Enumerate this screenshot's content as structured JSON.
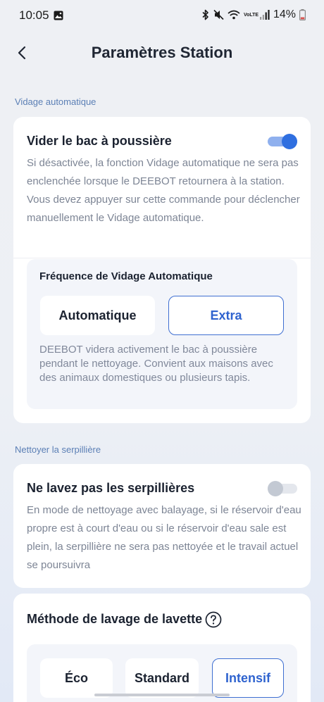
{
  "status_bar": {
    "time": "10:05",
    "battery": "14%",
    "icons": [
      "gallery-icon",
      "bluetooth-icon",
      "mute-icon",
      "wifi-icon",
      "volte-icon",
      "signal-icon",
      "battery-icon"
    ],
    "volte_text": "VoLTE"
  },
  "header": {
    "title": "Paramètres Station",
    "back_icon": "chevron-left-icon"
  },
  "auto_empty": {
    "section_label": "Vidage automatique",
    "toggle_title": "Vider le bac à poussière",
    "toggle_on": true,
    "description": "Si désactivée, la fonction Vidage automatique ne sera pas enclenchée lorsque le DEEBOT retournera à la station. Vous devez appuyer sur cette commande pour déclencher manuellement le Vidage automatique.",
    "frequency": {
      "title": "Fréquence de Vidage Automatique",
      "options": [
        "Automatique",
        "Extra"
      ],
      "selected": "Extra",
      "description": "DEEBOT videra activement le bac à poussière pendant le nettoyage. Convient aux maisons avec des animaux domestiques ou plusieurs tapis."
    }
  },
  "mop_clean": {
    "section_label": "Nettoyer la serpillière",
    "toggle_title": "Ne lavez pas les serpillières",
    "toggle_on": false,
    "description": "En mode de nettoyage avec balayage, si le réservoir d'eau propre est à court d'eau ou si le réservoir d'eau sale est plein, la serpillière ne sera pas nettoyée et le travail actuel se poursuivra"
  },
  "wash_method": {
    "title": "Méthode de lavage de lavette",
    "help_icon": "question-circle-icon",
    "options": [
      "Éco",
      "Standard",
      "Intensif"
    ],
    "selected": "Intensif"
  },
  "colors": {
    "accent": "#2f6fe0",
    "section_label": "#5b7fb5",
    "selected_border": "#3f6fd1"
  }
}
